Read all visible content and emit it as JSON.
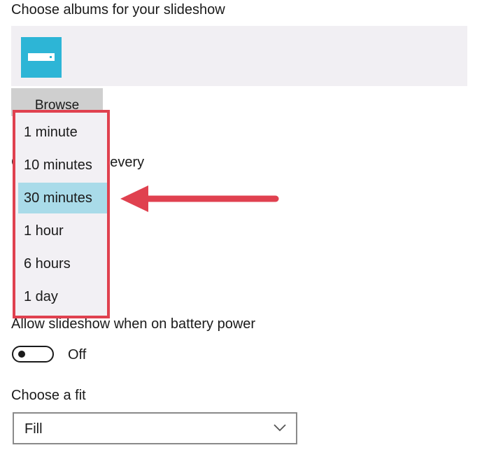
{
  "albums": {
    "title": "Choose albums for your slideshow",
    "browse_label": "Browse",
    "icon": "folder-icon"
  },
  "change_picture": {
    "label": "Change picture every"
  },
  "interval_dropdown": {
    "options": [
      "1 minute",
      "10 minutes",
      "30 minutes",
      "1 hour",
      "6 hours",
      "1 day"
    ],
    "selected_index": 2,
    "highlight_color": "#e0414f",
    "selected_color": "#a9dbe9"
  },
  "battery": {
    "label": "Allow slideshow when on battery power",
    "toggle_state": "Off",
    "toggle_on": false
  },
  "fit": {
    "label": "Choose a fit",
    "value": "Fill",
    "icon": "chevron-down-icon"
  },
  "annotation": {
    "arrow_color": "#e0414f",
    "icon": "arrow-left-icon"
  },
  "accent_color": "#2db5d6"
}
